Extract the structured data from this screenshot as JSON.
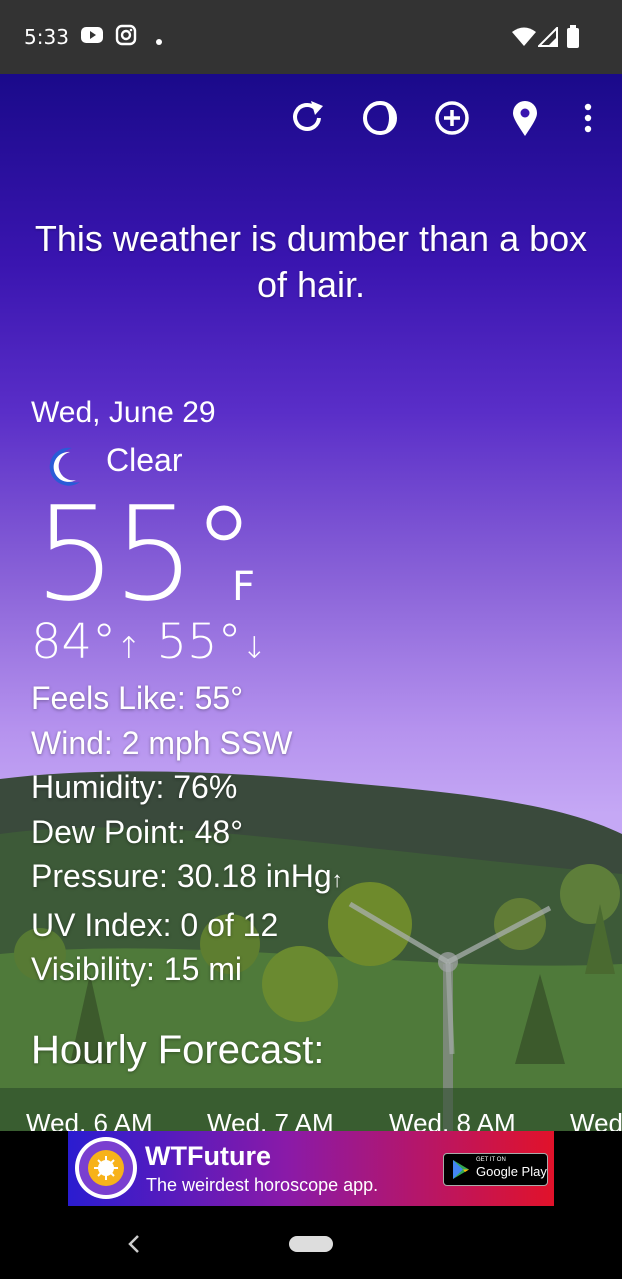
{
  "status_bar": {
    "time": "5:33"
  },
  "toolbar": {
    "icons": [
      "refresh-icon",
      "moon-phase-icon",
      "add-location-icon",
      "location-pin-icon",
      "more-vert-icon"
    ]
  },
  "tagline": "This weather is dumber than a box of hair.",
  "current": {
    "date": "Wed, June 29",
    "condition": "Clear",
    "temperature": "55°",
    "unit": "F",
    "high": "84°",
    "low": "55°"
  },
  "details": {
    "feels_like": "Feels Like:  55°",
    "wind": "Wind:  2 mph SSW",
    "humidity": "Humidity:  76%",
    "dew_point": "Dew Point:  48°",
    "pressure": "Pressure:  30.18 inHg",
    "uv_index": "UV Index:  0 of 12",
    "visibility": "Visibility:  15 mi"
  },
  "hourly": {
    "title": "Hourly Forecast:",
    "items": [
      "Wed, 6 AM",
      "Wed, 7 AM",
      "Wed, 8 AM",
      "Wed"
    ]
  },
  "ad": {
    "title": "WTFuture",
    "subtitle": "The weirdest horoscope app.",
    "store_small": "GET IT ON",
    "store_big": "Google Play"
  },
  "colors": {
    "accent_blue": "#2a5bd7",
    "ad_start": "#2a1cd0",
    "ad_end": "#e1122a"
  }
}
